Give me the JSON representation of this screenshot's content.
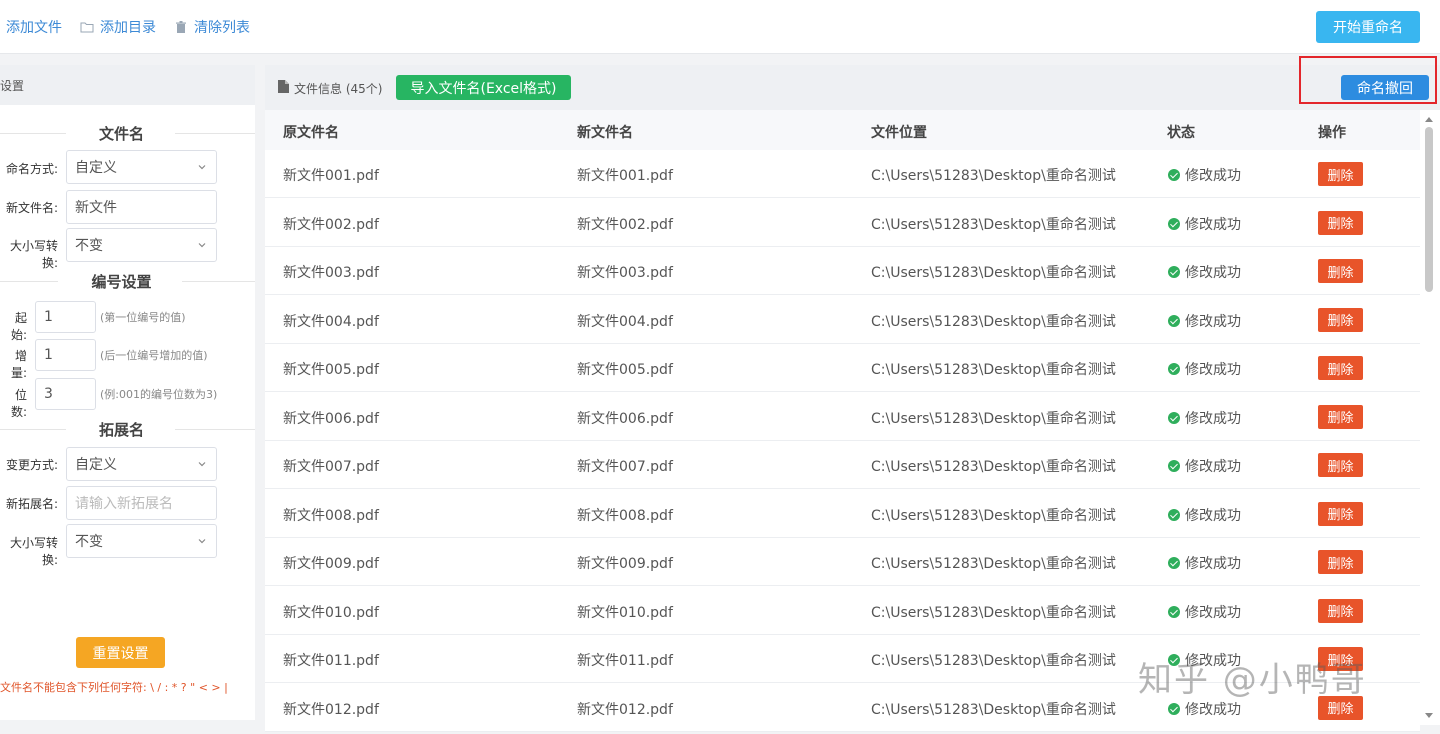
{
  "toolbar": {
    "add_file": "添加文件",
    "add_dir": "添加目录",
    "clear_list": "清除列表",
    "start_rename": "开始重命名"
  },
  "left_panel": {
    "header": "设置",
    "filename_section": {
      "title": "文件名",
      "naming_mode_label": "命名方式:",
      "naming_mode_value": "自定义",
      "new_name_label": "新文件名:",
      "new_name_value": "新文件",
      "case_label": "大小写转换:",
      "case_value": "不变"
    },
    "number_section": {
      "title": "编号设置",
      "start_label": "起始:",
      "start_value": "1",
      "start_hint": "(第一位编号的值)",
      "step_label": "增量:",
      "step_value": "1",
      "step_hint": "(后一位编号增加的值)",
      "digits_label": "位数:",
      "digits_value": "3",
      "digits_hint": "(例:001的编号位数为3)"
    },
    "ext_section": {
      "title": "拓展名",
      "mode_label": "变更方式:",
      "mode_value": "自定义",
      "new_ext_label": "新拓展名:",
      "new_ext_placeholder": "请输入新拓展名",
      "case_label": "大小写转换:",
      "case_value": "不变"
    },
    "reset_button": "重置设置",
    "warning": "文件名不能包含下列任何字符: \\ / : * ? \" < > |"
  },
  "right_panel": {
    "title": "文件信息",
    "count": "(45个)",
    "import_button": "导入文件名(Excel格式)",
    "undo_button": "命名撤回",
    "columns": [
      "原文件名",
      "新文件名",
      "文件位置",
      "状态",
      "操作"
    ],
    "delete_label": "删除",
    "rows": [
      {
        "orig": "新文件001.pdf",
        "new": "新文件001.pdf",
        "loc": "C:\\Users\\51283\\Desktop\\重命名测试",
        "status": "修改成功"
      },
      {
        "orig": "新文件002.pdf",
        "new": "新文件002.pdf",
        "loc": "C:\\Users\\51283\\Desktop\\重命名测试",
        "status": "修改成功"
      },
      {
        "orig": "新文件003.pdf",
        "new": "新文件003.pdf",
        "loc": "C:\\Users\\51283\\Desktop\\重命名测试",
        "status": "修改成功"
      },
      {
        "orig": "新文件004.pdf",
        "new": "新文件004.pdf",
        "loc": "C:\\Users\\51283\\Desktop\\重命名测试",
        "status": "修改成功"
      },
      {
        "orig": "新文件005.pdf",
        "new": "新文件005.pdf",
        "loc": "C:\\Users\\51283\\Desktop\\重命名测试",
        "status": "修改成功"
      },
      {
        "orig": "新文件006.pdf",
        "new": "新文件006.pdf",
        "loc": "C:\\Users\\51283\\Desktop\\重命名测试",
        "status": "修改成功"
      },
      {
        "orig": "新文件007.pdf",
        "new": "新文件007.pdf",
        "loc": "C:\\Users\\51283\\Desktop\\重命名测试",
        "status": "修改成功"
      },
      {
        "orig": "新文件008.pdf",
        "new": "新文件008.pdf",
        "loc": "C:\\Users\\51283\\Desktop\\重命名测试",
        "status": "修改成功"
      },
      {
        "orig": "新文件009.pdf",
        "new": "新文件009.pdf",
        "loc": "C:\\Users\\51283\\Desktop\\重命名测试",
        "status": "修改成功"
      },
      {
        "orig": "新文件010.pdf",
        "new": "新文件010.pdf",
        "loc": "C:\\Users\\51283\\Desktop\\重命名测试",
        "status": "修改成功"
      },
      {
        "orig": "新文件011.pdf",
        "new": "新文件011.pdf",
        "loc": "C:\\Users\\51283\\Desktop\\重命名测试",
        "status": "修改成功"
      },
      {
        "orig": "新文件012.pdf",
        "new": "新文件012.pdf",
        "loc": "C:\\Users\\51283\\Desktop\\重命名测试",
        "status": "修改成功"
      }
    ]
  },
  "watermark": "知乎 @小鸭哥",
  "colors": {
    "link_blue": "#3d8ad6",
    "start_button": "#39b6f0",
    "import_button": "#27b562",
    "undo_button": "#2d8ce0",
    "delete_button": "#e8542a",
    "reset_button": "#f5a623",
    "highlight_box": "#e3262b",
    "status_ok": "#2fae5c"
  },
  "icons": {
    "add_dir": "folder-icon",
    "clear_list": "trash-icon",
    "file_info": "document-icon",
    "select": "chevron-down-icon",
    "status_ok": "check-circle-icon"
  }
}
